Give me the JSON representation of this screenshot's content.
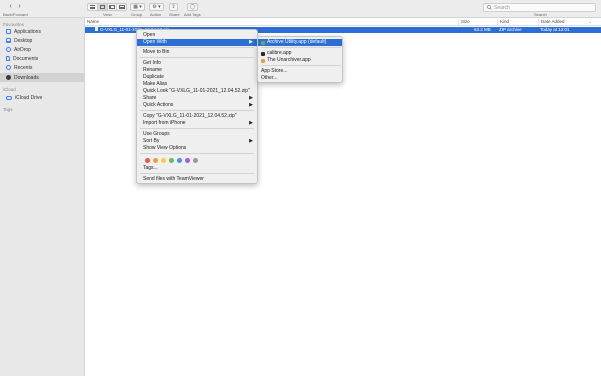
{
  "toolbar": {
    "back_forward_label": "Back/Forward",
    "view_label": "View",
    "group_label": "Group",
    "action_label": "Action",
    "share_label": "Share",
    "add_tags_label": "Add Tags",
    "search_placeholder": "Search",
    "search_label": "Search",
    "back_glyph": "‹",
    "forward_glyph": "›",
    "group_glyph": "▦ ▾",
    "action_glyph": "⚙ ▾",
    "share_glyph": "⇪",
    "tags_glyph": "◯"
  },
  "sidebar": {
    "favourites_heading": "Favourites",
    "items": [
      {
        "label": "Applications",
        "icon": "applications-icon"
      },
      {
        "label": "Desktop",
        "icon": "desktop-icon"
      },
      {
        "label": "AirDrop",
        "icon": "airdrop-icon"
      },
      {
        "label": "Documents",
        "icon": "documents-icon"
      },
      {
        "label": "Recents",
        "icon": "recents-icon"
      },
      {
        "label": "Downloads",
        "icon": "downloads-icon"
      }
    ],
    "icloud_heading": "iCloud",
    "icloud_items": [
      {
        "label": "iCloud Drive",
        "icon": "icloud-icon"
      }
    ],
    "tags_heading": "Tags"
  },
  "list": {
    "columns": {
      "name": "Name",
      "size": "Size",
      "kind": "Kind",
      "date_added": "Date Added",
      "sort_glyph": "⌄"
    },
    "selected_row": {
      "name": "G-VXLG_11-01-2021_12.04.52.zip",
      "size": "63.2 MB",
      "kind": "ZIP archive",
      "date_added": "Today at 12:01"
    }
  },
  "context_menu": {
    "items": [
      {
        "label": "Open"
      },
      {
        "label": "Open With",
        "has_submenu": true
      },
      {
        "label": "Move to Bin"
      },
      {
        "label": "Get Info"
      },
      {
        "label": "Rename"
      },
      {
        "label": "Duplicate"
      },
      {
        "label": "Make Alias"
      },
      {
        "label": "Quick Look \"G-VXLG_11-01-2021_12.04.52.zip\""
      },
      {
        "label": "Share",
        "has_submenu": true
      },
      {
        "label": "Quick Actions",
        "has_submenu": true
      },
      {
        "label": "Copy \"G-VXLG_11-01-2021_12.04.52.zip\""
      },
      {
        "label": "Import from iPhone",
        "has_submenu": true
      },
      {
        "label": "Use Groups"
      },
      {
        "label": "Sort By",
        "has_submenu": true
      },
      {
        "label": "Show View Options"
      },
      {
        "label": "Tags..."
      },
      {
        "label": "Send files with TeamViewer"
      }
    ],
    "submenu_arrow": "▶",
    "tag_colors": [
      "#e8564a",
      "#f29b38",
      "#f5cf3f",
      "#5cc257",
      "#4a90e2",
      "#a25ddc",
      "#9a9a9a"
    ]
  },
  "open_with_submenu": {
    "items": [
      {
        "label": "Archive Utility.app (default)",
        "color": "#6aa84f"
      },
      {
        "label": "calibre.app",
        "color": "#2a2a2a"
      },
      {
        "label": "The Unarchiver.app",
        "color": "#d9a441"
      },
      {
        "label": "App Store..."
      },
      {
        "label": "Other..."
      }
    ]
  },
  "colors": {
    "selection_blue": "#2b6fd6"
  }
}
